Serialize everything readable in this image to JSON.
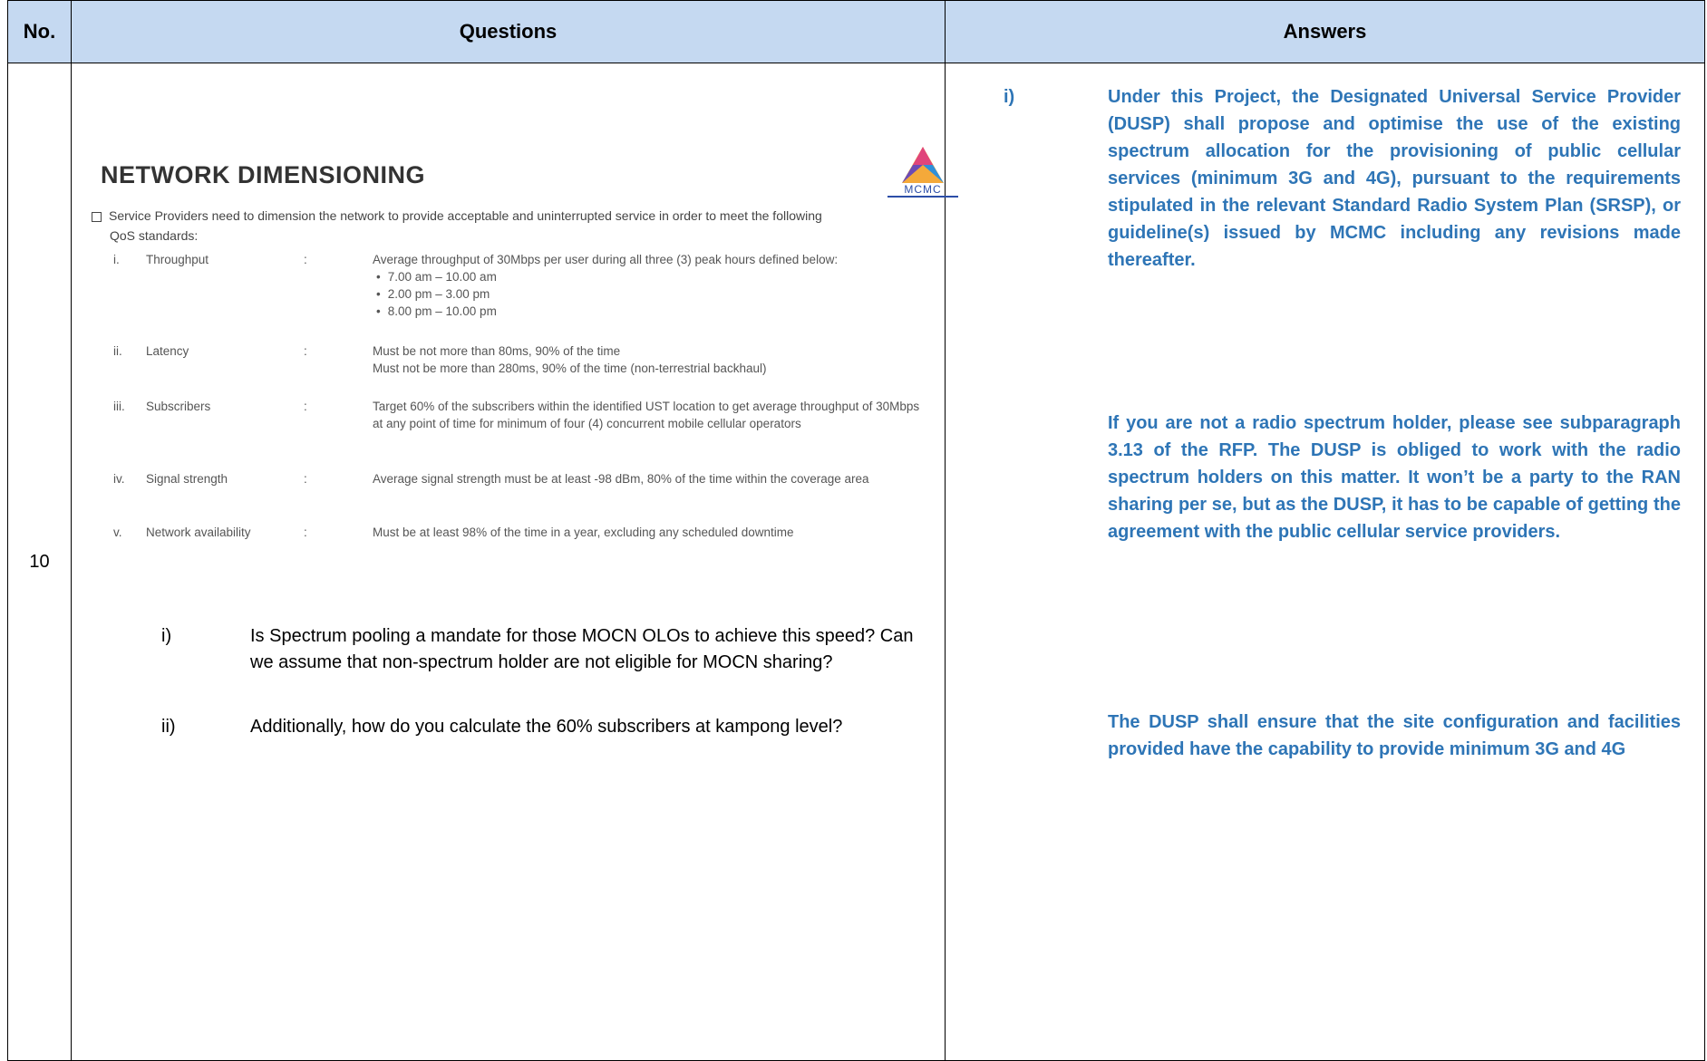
{
  "table": {
    "headers": {
      "no": "No.",
      "questions": "Questions",
      "answers": "Answers"
    },
    "row": {
      "no": "10"
    }
  },
  "slide": {
    "title": "NETWORK DIMENSIONING",
    "logo_text": "MCMC",
    "intro_line1": "Service Providers need to dimension the network to provide acceptable and uninterrupted service in order to meet the following",
    "intro_line2": "QoS standards:",
    "qos": [
      {
        "num": "i.",
        "label": "Throughput",
        "colon": ":",
        "desc": "Average throughput of 30Mbps per user during all three (3) peak hours defined below:",
        "bullets": [
          "7.00 am – 10.00 am",
          "2.00 pm – 3.00 pm",
          "8.00 pm – 10.00 pm"
        ]
      },
      {
        "num": "ii.",
        "label": "Latency",
        "colon": ":",
        "desc": "Must be not more than 80ms, 90% of the time",
        "desc2": "Must not be more than 280ms, 90% of the time (non-terrestrial backhaul)"
      },
      {
        "num": "iii.",
        "label": "Subscribers",
        "colon": ":",
        "desc": "Target 60% of the subscribers within the identified UST location to get average throughput of 30Mbps at any point  of time for minimum of four (4) concurrent mobile cellular operators"
      },
      {
        "num": "iv.",
        "label": "Signal strength",
        "colon": ":",
        "desc": "Average signal strength must be at least -98 dBm, 80% of the time within the coverage area"
      },
      {
        "num": "v.",
        "label": "Network availability",
        "colon": ":",
        "desc": "Must be at least 98% of the time in a year, excluding any scheduled downtime"
      }
    ]
  },
  "questions": [
    {
      "num": "i)",
      "text": "Is Spectrum pooling a mandate for those MOCN OLOs to achieve this speed? Can we assume that non-spectrum holder are not eligible for MOCN sharing?"
    },
    {
      "num": "ii)",
      "text": "Additionally, how do you calculate the 60% subscribers at kampong level?"
    }
  ],
  "answers": {
    "num": "i)",
    "paragraphs": [
      "Under this Project, the Designated Universal Service Provider (DUSP) shall propose and optimise the use of the existing spectrum allocation for the provisioning of public cellular services (minimum 3G and 4G), pursuant to the requirements stipulated in the relevant Standard Radio System Plan (SRSP), or guideline(s) issued by MCMC including any revisions made thereafter.",
      "If you are not a radio spectrum holder, please see subparagraph 3.13 of the RFP. The DUSP is obliged to work with the radio spectrum holders on this matter. It won’t be a party to the RAN sharing per se, but as the DUSP, it has to be capable of getting the agreement with the public cellular service providers.",
      "The DUSP shall ensure that the site configuration and facilities provided have the capability to provide minimum 3G and 4G"
    ]
  }
}
